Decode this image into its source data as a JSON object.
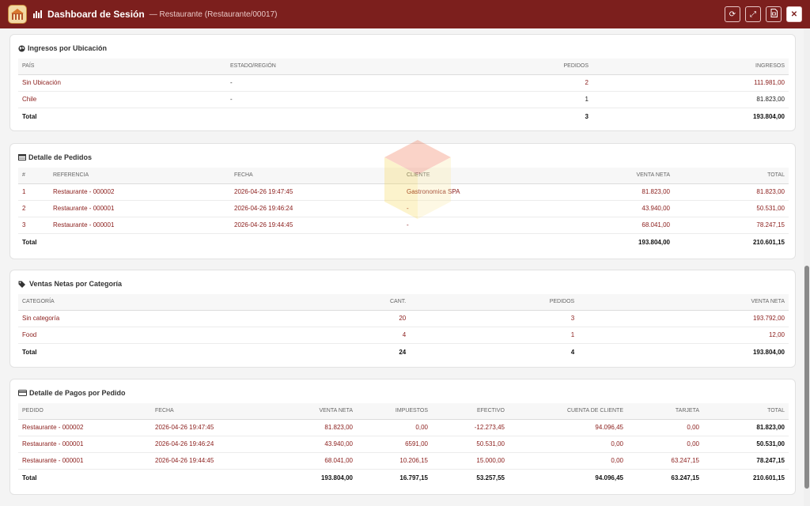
{
  "titlebar": {
    "title": "Dashboard de Sesión",
    "subtitle": "— Restaurante (Restaurante/00017)",
    "logo_icon": "restaurant-logo-icon",
    "chart_icon": "bar-chart-icon",
    "actions": [
      "refresh-icon",
      "expand-icon",
      "pdf-icon",
      "close-icon"
    ],
    "accent": "#7c1f1d"
  },
  "ubicacion": {
    "title": "Ingresos por Ubicación",
    "headers": [
      "PAÍS",
      "ESTADO/REGIÓN",
      "PEDIDOS",
      "INGRESOS"
    ],
    "rows": [
      [
        "Sin Ubicación",
        "-",
        "2",
        "111.981,00"
      ],
      [
        "Chile",
        "-",
        "1",
        "81.823,00"
      ]
    ],
    "total": [
      "Total",
      "",
      "3",
      "193.804,00"
    ]
  },
  "pedidos": {
    "title": "Detalle de Pedidos",
    "headers": [
      "#",
      "REFERENCIA",
      "FECHA",
      "CLIENTE",
      "VENTA NETA",
      "TOTAL"
    ],
    "rows": [
      [
        "1",
        "Restaurante - 000002",
        "2026-04-26 19:47:45",
        "Gastronomica SPA",
        "81.823,00",
        "81.823,00"
      ],
      [
        "2",
        "Restaurante - 000001",
        "2026-04-26 19:46:24",
        "-",
        "43.940,00",
        "50.531,00"
      ],
      [
        "3",
        "Restaurante - 000001",
        "2026-04-26 19:44:45",
        "-",
        "68.041,00",
        "78.247,15"
      ]
    ],
    "total": [
      "Total",
      "",
      "",
      "",
      "193.804,00",
      "210.601,15"
    ]
  },
  "categorias": {
    "title": "Ventas Netas por Categoría",
    "headers": [
      "CATEGORÍA",
      "CANT.",
      "PEDIDOS",
      "VENTA NETA"
    ],
    "rows": [
      [
        "Sin categoría",
        "20",
        "3",
        "193.792,00"
      ],
      [
        "Food",
        "4",
        "1",
        "12,00"
      ]
    ],
    "total": [
      "Total",
      "24",
      "4",
      "193.804,00"
    ]
  },
  "pagos": {
    "title": "Detalle de Pagos por Pedido",
    "headers": [
      "PEDIDO",
      "FECHA",
      "VENTA NETA",
      "IMPUESTOS",
      "EFECTIVO",
      "CUENTA DE CLIENTE",
      "TARJETA",
      "TOTAL"
    ],
    "rows": [
      [
        "Restaurante - 000002",
        "2026-04-26 19:47:45",
        "81.823,00",
        "0,00",
        "-12.273,45",
        "94.096,45",
        "0,00",
        "81.823,00"
      ],
      [
        "Restaurante - 000001",
        "2026-04-26 19:46:24",
        "43.940,00",
        "6591,00",
        "50.531,00",
        "0,00",
        "0,00",
        "50.531,00"
      ],
      [
        "Restaurante - 000001",
        "2026-04-26 19:44:45",
        "68.041,00",
        "10.206,15",
        "15.000,00",
        "0,00",
        "63.247,15",
        "78.247,15"
      ]
    ],
    "total": [
      "Total",
      "",
      "193.804,00",
      "16.797,15",
      "53.257,55",
      "94.096,45",
      "63.247,15",
      "210.601,15"
    ]
  }
}
